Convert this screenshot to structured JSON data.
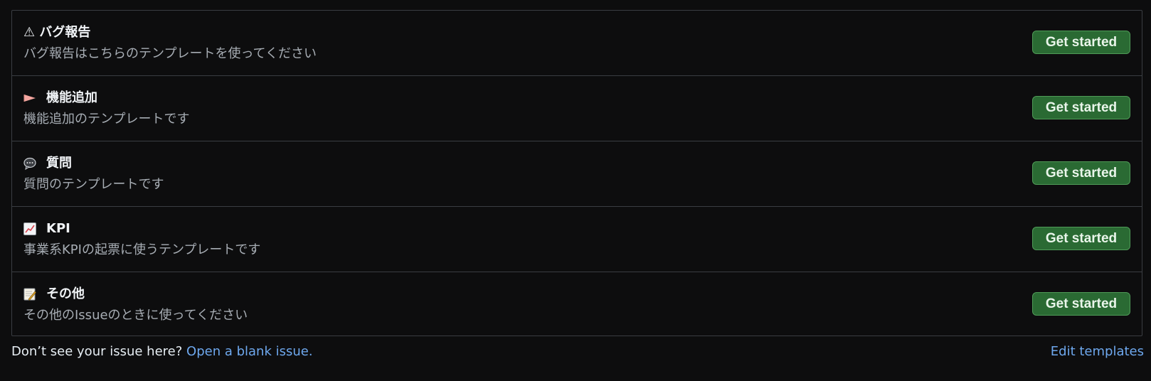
{
  "templates": [
    {
      "icon": "warning-icon",
      "title": "⚠ バグ報告",
      "description": "バグ報告はこちらのテンプレートを使ってください",
      "button": "Get started"
    },
    {
      "icon": "flag-icon",
      "title": "機能追加",
      "description": "機能追加のテンプレートです",
      "button": "Get started"
    },
    {
      "icon": "speech-bubble-icon",
      "title": "質問",
      "description": "質問のテンプレートです",
      "button": "Get started"
    },
    {
      "icon": "chart-icon",
      "title": "KPI",
      "description": "事業系KPIの起票に使うテンプレートです",
      "button": "Get started"
    },
    {
      "icon": "memo-icon",
      "title": "その他",
      "description": "その他のIssueのときに使ってください",
      "button": "Get started"
    }
  ],
  "footer": {
    "prompt": "Don’t see your issue here?",
    "blank_issue_link": "Open a blank issue.",
    "edit_templates_link": "Edit templates"
  },
  "colors": {
    "background": "#0d0d0e",
    "button_bg": "#2a6a33",
    "link": "#6ea8ee"
  }
}
